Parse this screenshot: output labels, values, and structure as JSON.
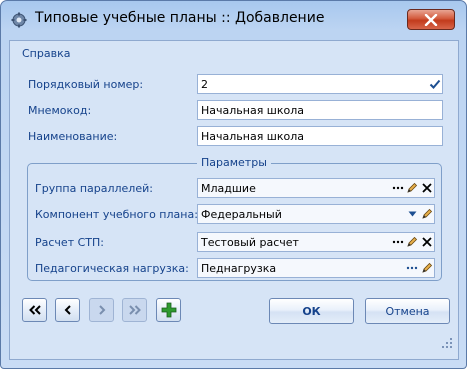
{
  "window": {
    "title": "Типовые учебные планы :: Добавление"
  },
  "menu": {
    "help_label": "Справка"
  },
  "fields": {
    "order_number": {
      "label": "Порядковый номер:",
      "value": "2"
    },
    "mnemocode": {
      "label": "Мнемокод:",
      "value": "Начальная школа"
    },
    "name": {
      "label": "Наименование:",
      "value": "Начальная школа"
    }
  },
  "params": {
    "legend": "Параметры",
    "parallel_group": {
      "label": "Группа параллелей:",
      "value": "Младшие"
    },
    "plan_component": {
      "label": "Компонент учебного плана:",
      "value": "Федеральный"
    },
    "stp_calc": {
      "label": "Расчет СТП:",
      "value": "Тестовый расчет"
    },
    "ped_load": {
      "label": "Педагогическая нагрузка:",
      "value": "Педнагрузка"
    }
  },
  "buttons": {
    "ok_label": "ОК",
    "cancel_label": "Отмена"
  },
  "colors": {
    "label_text": "#15428b",
    "client_bg": "#d6e4f6",
    "close_button": "#c23b1c",
    "add_button": "#2f9a2f"
  }
}
